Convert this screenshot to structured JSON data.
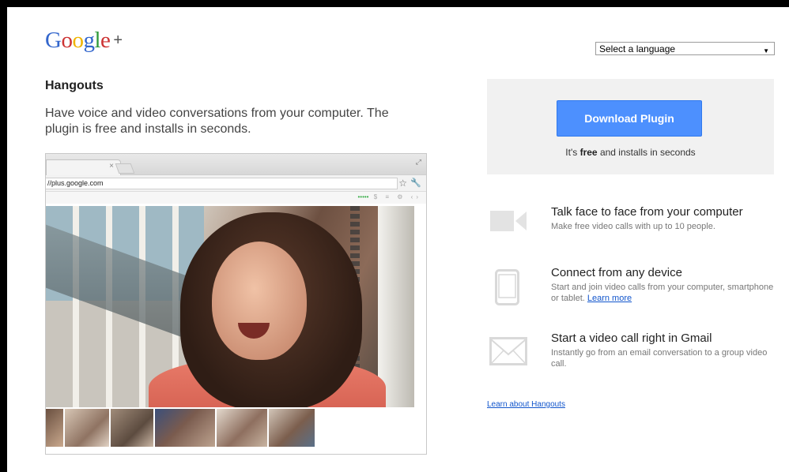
{
  "logo": {
    "letters": [
      {
        "char": "G",
        "color": "#3366cc"
      },
      {
        "char": "o",
        "color": "#cc3333"
      },
      {
        "char": "o",
        "color": "#f0b400"
      },
      {
        "char": "g",
        "color": "#3366cc"
      },
      {
        "char": "l",
        "color": "#2e9a3a"
      },
      {
        "char": "e",
        "color": "#cc3333"
      }
    ],
    "plus": "+"
  },
  "language": {
    "selected": "Select a language"
  },
  "product": {
    "title": "Hangouts",
    "tagline": "Have voice and video conversations from your computer. The plugin is free and installs in seconds."
  },
  "browser": {
    "tab_close": "×",
    "url": "//plus.google.com"
  },
  "download": {
    "button_label": "Download Plugin",
    "note_prefix": "It's ",
    "note_bold": "free",
    "note_suffix": " and installs in seconds",
    "button_color": "#4d90fe"
  },
  "features": [
    {
      "icon": "video-camera-icon",
      "title": "Talk face to face from your computer",
      "description": "Make free video calls with up to 10 people."
    },
    {
      "icon": "phone-icon",
      "title": "Connect from any device",
      "description": "Start and join video calls from your computer, smartphone or tablet. ",
      "link": "Learn more"
    },
    {
      "icon": "mail-icon",
      "title": "Start a video call right in Gmail",
      "description": "Instantly go from an email conversation to a group video call."
    }
  ],
  "learn_about": "Learn about Hangouts",
  "colors": {
    "icon_gray": "#e3e3e3",
    "link": "#1155cc"
  }
}
